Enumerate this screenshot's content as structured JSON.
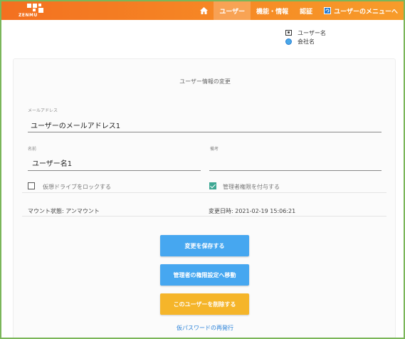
{
  "header": {
    "logo_text": "ZENMU",
    "nav": {
      "users": "ユーザー",
      "features": "機能・情報",
      "auth": "認証",
      "user_menu": "ユーザーのメニューへ"
    }
  },
  "userinfo": {
    "username": "ユーザー名",
    "company": "会社名"
  },
  "form": {
    "title": "ユーザー情報の変更",
    "email_label": "メールアドレス",
    "email_value": "ユーザーのメールアドレス1",
    "name_label": "名前",
    "name_value": "ユーザー名1",
    "note_label": "備考",
    "note_value": "",
    "lock_drive_label": "仮想ドライブをロックする",
    "lock_drive_checked": false,
    "admin_label": "管理者権限を付与する",
    "admin_checked": true,
    "mount_status": "マウント状態: アンマウント",
    "modified_at": "変更日時: 2021-02-19 15:06:21"
  },
  "buttons": {
    "save": "変更を保存する",
    "admin_settings": "管理者の権限設定へ移動",
    "delete": "このユーザーを削除する",
    "reissue_link": "仮パスワードの再発行"
  },
  "colors": {
    "header": "#f68a25",
    "primary_button": "#46a7f0",
    "danger_button": "#f5b52a",
    "checkbox_checked": "#3fa894",
    "frame_border": "#7bb65a"
  }
}
